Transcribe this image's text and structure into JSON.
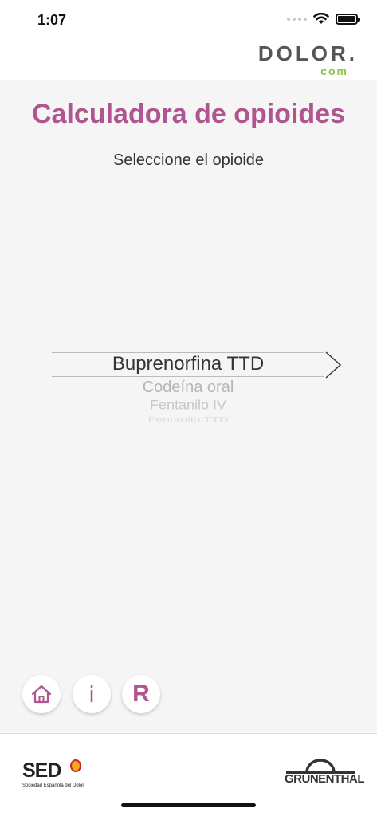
{
  "status_bar": {
    "time": "1:07"
  },
  "brand": {
    "main": "DOLOR.",
    "sub": "com"
  },
  "page": {
    "title": "Calculadora de opioides",
    "subtitle": "Seleccione el opioide"
  },
  "picker": {
    "options": [
      "Buprenorfina TTD",
      "Codeína oral",
      "Fentanilo IV",
      "Fentanilo TTD"
    ],
    "selected_index": 0
  },
  "buttons": {
    "info_label": "i",
    "r_label": "R"
  },
  "footer": {
    "sed_logo": "SED",
    "sed_caption": "Sociedad Española del Dolor",
    "grunenthal_logo": "GRÜNENTHAL"
  },
  "colors": {
    "accent": "#b0558f",
    "brand_green": "#8bc34a"
  }
}
